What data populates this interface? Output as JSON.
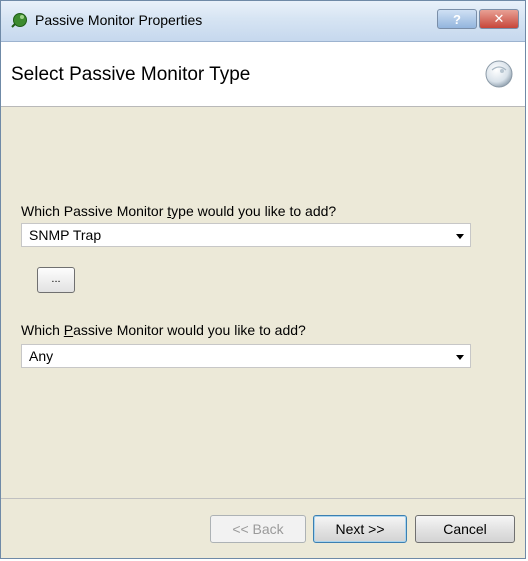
{
  "window": {
    "title": "Passive Monitor Properties",
    "help_label": "?",
    "close_label": "✕"
  },
  "header": {
    "title": "Select Passive Monitor Type"
  },
  "form": {
    "type_label_pre": "Which Passive Monitor ",
    "type_label_access": "t",
    "type_label_post": "ype would you like to add?",
    "type_value": "SNMP Trap",
    "monitor_label_pre": "Which ",
    "monitor_label_access": "P",
    "monitor_label_post": "assive Monitor would you like to add?",
    "monitor_value": "Any",
    "browse_label": "..."
  },
  "buttons": {
    "back": "<< Back",
    "next": "Next >>",
    "cancel": "Cancel"
  },
  "colors": {
    "dialog_bg": "#ece9d8",
    "titlebar": "#d6e4f3",
    "close": "#c7463a"
  }
}
